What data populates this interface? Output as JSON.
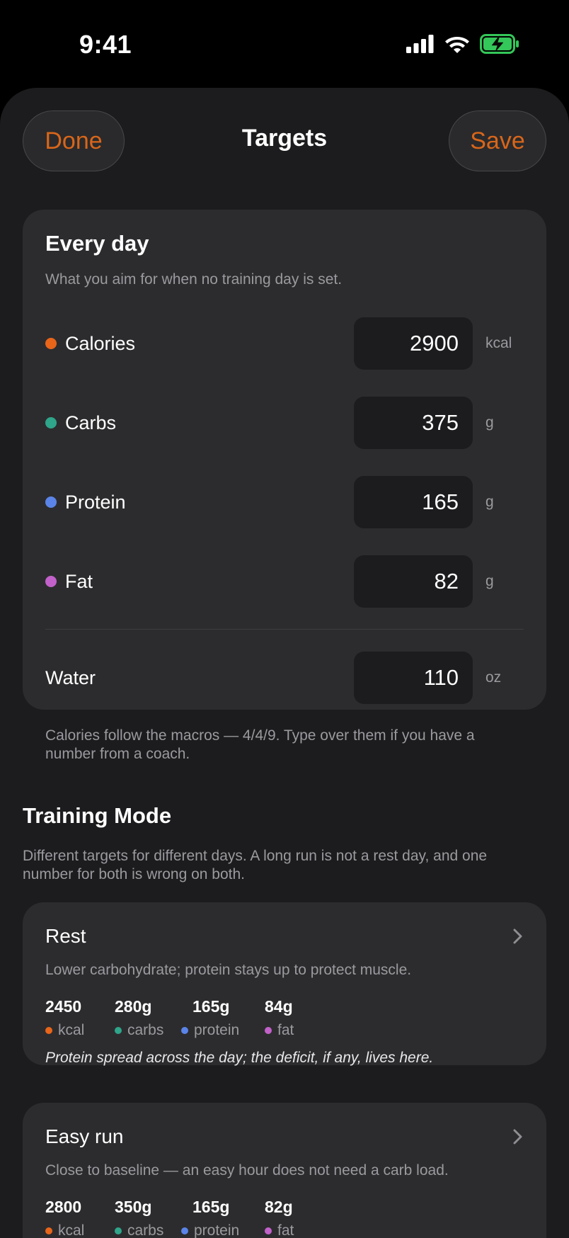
{
  "status": {
    "time": "9:41"
  },
  "nav": {
    "done": "Done",
    "title": "Targets",
    "save": "Save"
  },
  "everyday": {
    "title": "Every day",
    "subtitle": "What you aim for when no training day is set.",
    "rows": [
      {
        "label": "Calories",
        "value": "2900",
        "unit": "kcal",
        "color": "#e8651a"
      },
      {
        "label": "Carbs",
        "value": "375",
        "unit": "g",
        "color": "#2fa58a"
      },
      {
        "label": "Protein",
        "value": "165",
        "unit": "g",
        "color": "#5b84e8"
      },
      {
        "label": "Fat",
        "value": "82",
        "unit": "g",
        "color": "#c261c9"
      }
    ],
    "water": {
      "label": "Water",
      "value": "110",
      "unit": "oz"
    },
    "footnote": "Calories follow the macros — 4/4/9. Type over them if you have a number from a coach."
  },
  "training": {
    "title": "Training Mode",
    "subtitle": "Different targets for different days. A long run is not a rest day, and one number for both is wrong on both.",
    "macro_labels": [
      "kcal",
      "carbs",
      "protein",
      "fat"
    ],
    "modes": [
      {
        "name": "Rest",
        "description": "Lower carbohydrate; protein stays up to protect muscle.",
        "values": [
          "2450",
          "280g",
          "165g",
          "84g"
        ],
        "note": "Protein spread across the day; the deficit, if any, lives here."
      },
      {
        "name": "Easy run",
        "description": "Close to baseline — an easy hour does not need a carb load.",
        "values": [
          "2800",
          "350g",
          "165g",
          "82g"
        ]
      }
    ]
  },
  "colors": {
    "accent": "#d8661a",
    "kcal": "#e8651a",
    "carbs": "#2fa58a",
    "protein": "#5b84e8",
    "fat": "#c261c9",
    "battery": "#34c759"
  },
  "icons": {
    "signal": "cellular-signal-icon",
    "wifi": "wifi-icon",
    "battery": "battery-charging-icon",
    "chevron": "chevron-right-icon"
  }
}
